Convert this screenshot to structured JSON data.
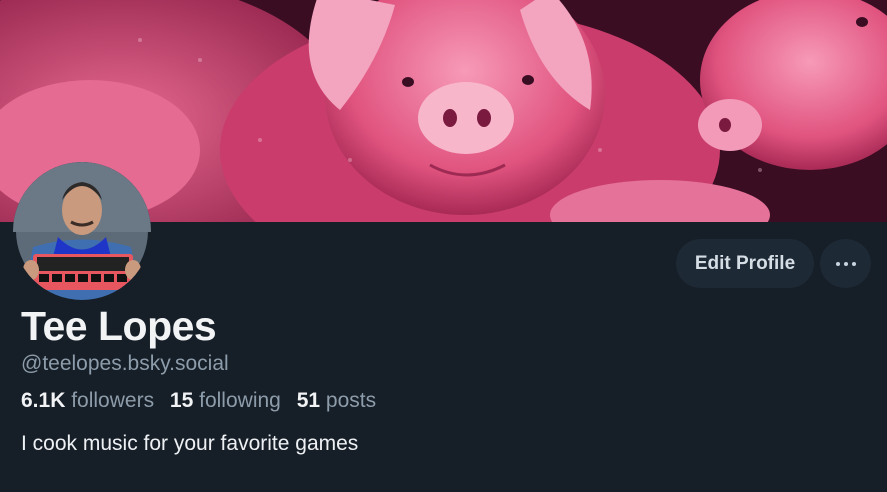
{
  "profile": {
    "display_name": "Tee Lopes",
    "handle": "@teelopes.bsky.social",
    "bio": "I cook music for your favorite games",
    "banner_icon": "pigs-banner-image",
    "avatar_icon": "user-avatar"
  },
  "stats": {
    "followers_count": "6.1K",
    "followers_label": "followers",
    "following_count": "15",
    "following_label": "following",
    "posts_count": "51",
    "posts_label": "posts"
  },
  "actions": {
    "edit_label": "Edit Profile",
    "more_icon": "ellipsis-icon"
  },
  "colors": {
    "background": "#161e27",
    "button_bg": "#1e2936",
    "banner_tint": "#e8457a"
  }
}
